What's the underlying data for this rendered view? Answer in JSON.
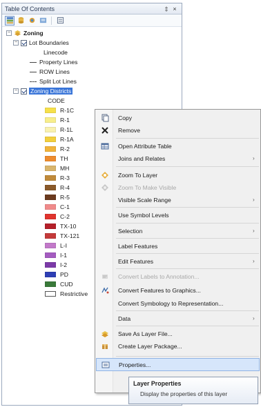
{
  "panel": {
    "title": "Table Of Contents",
    "pin": "‡",
    "close": "×"
  },
  "tree": {
    "root": "Zoning",
    "lot_group": "Lot Boundaries",
    "lot_field": "Linecode",
    "lot_items": [
      "Property Lines",
      "ROW Lines",
      "Split Lot Lines"
    ],
    "zoning_group": "Zoning Districts",
    "zoning_field": "CODE",
    "legend": [
      {
        "label": "R-1C",
        "color": "#f6e04a"
      },
      {
        "label": "R-1",
        "color": "#f8ee8c"
      },
      {
        "label": "R-1L",
        "color": "#f9f1b0"
      },
      {
        "label": "R-1A",
        "color": "#f2cf3e"
      },
      {
        "label": "R-2",
        "color": "#f1b43b"
      },
      {
        "label": "TH",
        "color": "#ee8c2e"
      },
      {
        "label": "MH",
        "color": "#d9b56c"
      },
      {
        "label": "R-3",
        "color": "#c08a3a"
      },
      {
        "label": "R-4",
        "color": "#8a5a2a"
      },
      {
        "label": "R-5",
        "color": "#6b3a1e"
      },
      {
        "label": "C-1",
        "color": "#f08a8a"
      },
      {
        "label": "C-2",
        "color": "#e0342e"
      },
      {
        "label": "TX-10",
        "color": "#b5202a"
      },
      {
        "label": "TX-121",
        "color": "#c43a3a"
      },
      {
        "label": "L-I",
        "color": "#c279c9"
      },
      {
        "label": "I-1",
        "color": "#a45cc0"
      },
      {
        "label": "I-2",
        "color": "#7c3aa8"
      },
      {
        "label": "PD",
        "color": "#2e3fb5"
      },
      {
        "label": "CUD",
        "color": "#3a7a3a"
      },
      {
        "label": "Restrictive",
        "color": "#ffffff"
      }
    ]
  },
  "menu": {
    "items": [
      {
        "label": "Copy",
        "icon": "copy-icon",
        "disabled": false,
        "submenu": false
      },
      {
        "label": "Remove",
        "icon": "remove-icon",
        "disabled": false,
        "submenu": false
      },
      {
        "label": "Open Attribute Table",
        "icon": "table-icon",
        "disabled": false,
        "submenu": false
      },
      {
        "label": "Joins and Relates",
        "icon": "",
        "disabled": false,
        "submenu": true
      },
      {
        "label": "Zoom To Layer",
        "icon": "zoom-layer-icon",
        "disabled": false,
        "submenu": false
      },
      {
        "label": "Zoom To Make Visible",
        "icon": "zoom-visible-icon",
        "disabled": true,
        "submenu": false
      },
      {
        "label": "Visible Scale Range",
        "icon": "",
        "disabled": false,
        "submenu": true
      },
      {
        "label": "Use Symbol Levels",
        "icon": "",
        "disabled": false,
        "submenu": false
      },
      {
        "label": "Selection",
        "icon": "",
        "disabled": false,
        "submenu": true
      },
      {
        "label": "Label Features",
        "icon": "",
        "disabled": false,
        "submenu": false
      },
      {
        "label": "Edit Features",
        "icon": "",
        "disabled": false,
        "submenu": true
      },
      {
        "label": "Convert Labels to Annotation...",
        "icon": "annotation-icon",
        "disabled": true,
        "submenu": false
      },
      {
        "label": "Convert Features to Graphics...",
        "icon": "graphics-icon",
        "disabled": false,
        "submenu": false
      },
      {
        "label": "Convert Symbology to Representation...",
        "icon": "",
        "disabled": false,
        "submenu": false
      },
      {
        "label": "Data",
        "icon": "",
        "disabled": false,
        "submenu": true
      },
      {
        "label": "Save As Layer File...",
        "icon": "layer-file-icon",
        "disabled": false,
        "submenu": false
      },
      {
        "label": "Create Layer Package...",
        "icon": "package-icon",
        "disabled": false,
        "submenu": false
      },
      {
        "label": "Properties...",
        "icon": "properties-icon",
        "disabled": false,
        "submenu": false
      }
    ]
  },
  "tooltip": {
    "title": "Layer Properties",
    "text": "Display the properties of this layer"
  }
}
